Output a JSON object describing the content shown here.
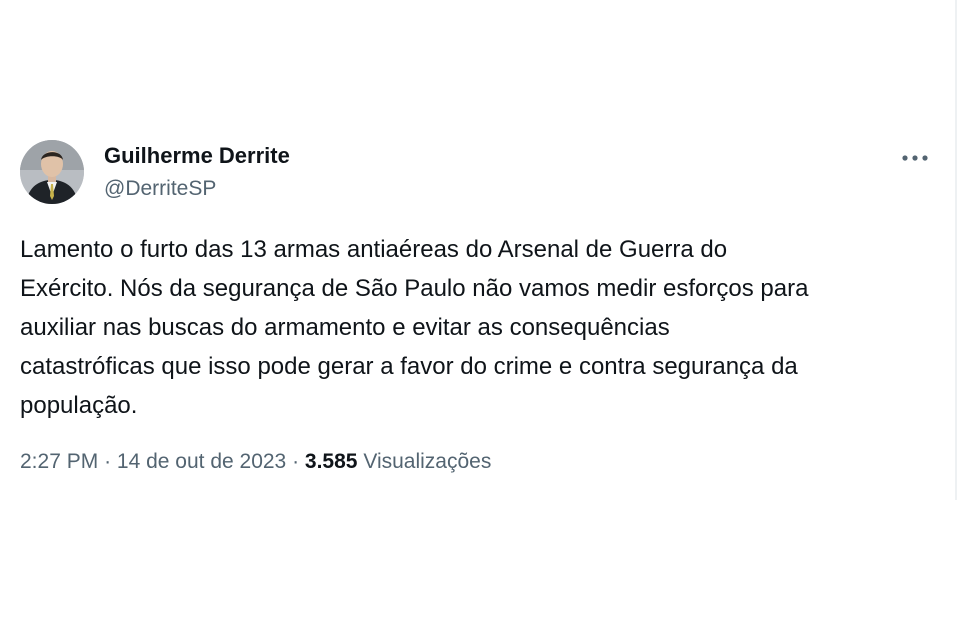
{
  "tweet": {
    "author_name": "Guilherme Derrite",
    "author_handle": "@DerriteSP",
    "more_icon": "more-horizontal-icon",
    "text": "Lamento o furto das 13 armas antiaéreas do Arsenal de Guerra do\nExército. Nós da segurança de São Paulo não vamos medir esforços para\nauxiliar nas buscas do armamento e evitar as consequências\ncatastróficas que isso pode gerar a favor do crime e contra segurança da\npopulação.",
    "time": "2:27 PM",
    "date": "14 de out de 2023",
    "views_count": "3.585",
    "views_label": "Visualizações",
    "separator": "·"
  },
  "colors": {
    "text_primary": "#0f1419",
    "text_secondary": "#536471",
    "background": "#ffffff"
  }
}
